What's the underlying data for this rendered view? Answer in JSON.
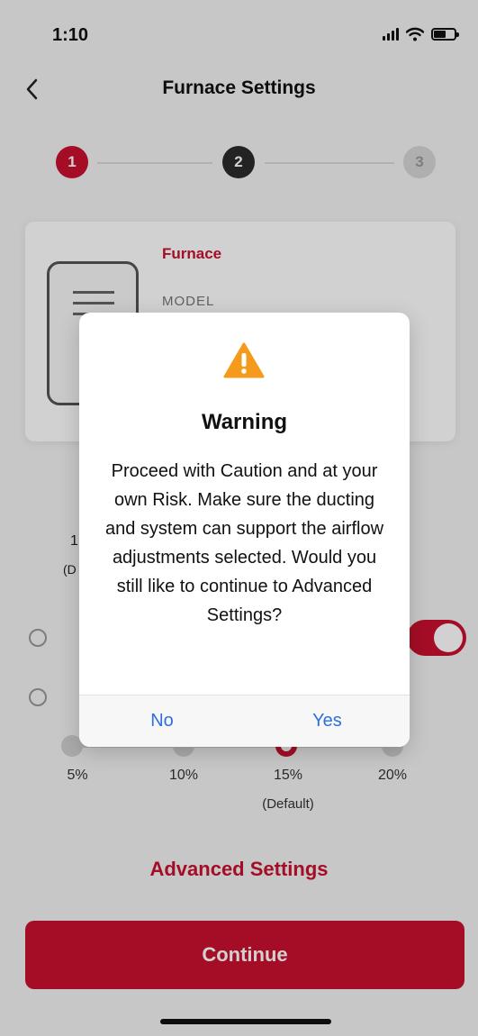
{
  "status_bar": {
    "time": "1:10"
  },
  "nav": {
    "title": "Furnace Settings"
  },
  "stepper": {
    "steps": [
      "1",
      "2",
      "3"
    ]
  },
  "product": {
    "name": "Furnace",
    "model_label": "MODEL"
  },
  "airflow": {
    "options": [
      "5%",
      "10%",
      "15%",
      "20%"
    ],
    "selected": "15%",
    "default_label": "(Default)",
    "peek_left_1": "1",
    "peek_left_2": "(D"
  },
  "advanced_link": "Advanced Settings",
  "continue_button": "Continue",
  "dialog": {
    "title": "Warning",
    "message": "Proceed with Caution and at your own Risk. Make sure the ducting and system can support the airflow adjustments selected. Would you still like to continue to Advanced Settings?",
    "no_label": "No",
    "yes_label": "Yes"
  },
  "colors": {
    "brand": "#c8102e",
    "link": "#2f6fe0",
    "warning": "#f59b1c"
  }
}
